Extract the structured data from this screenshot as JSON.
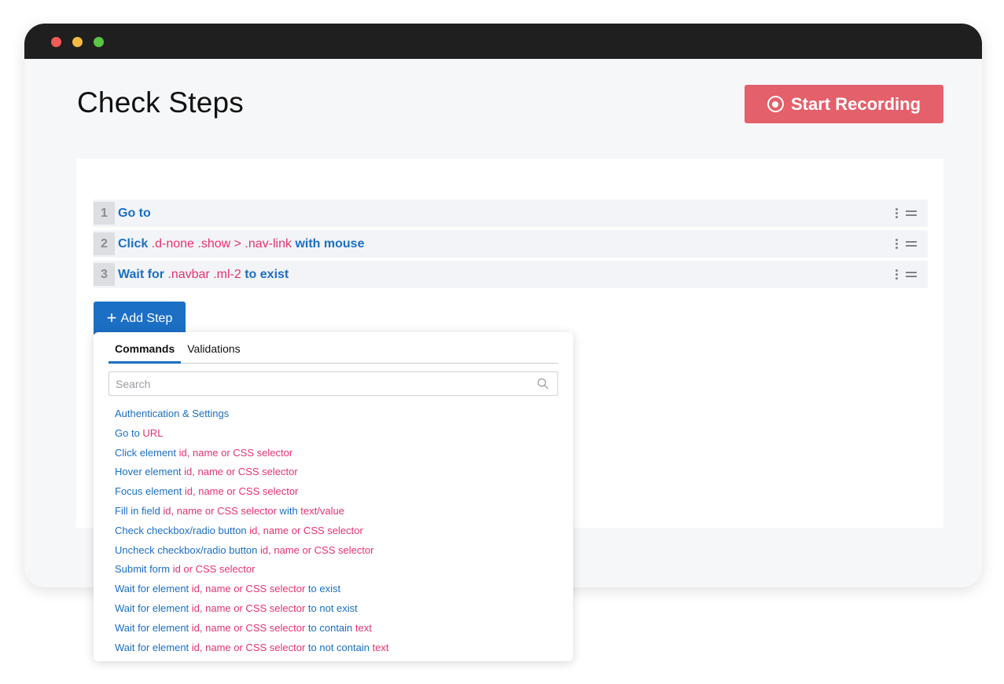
{
  "window": {
    "title": "Check Steps",
    "record_label": "Start Recording"
  },
  "steps": [
    {
      "num": "1",
      "parts": [
        {
          "t": "Go to",
          "k": "cmd"
        }
      ]
    },
    {
      "num": "2",
      "parts": [
        {
          "t": "Click ",
          "k": "cmd"
        },
        {
          "t": ".d-none .show > .nav-link",
          "k": "sel"
        },
        {
          "t": " with mouse",
          "k": "cmd"
        }
      ]
    },
    {
      "num": "3",
      "parts": [
        {
          "t": "Wait for ",
          "k": "cmd"
        },
        {
          "t": ".navbar .ml-2",
          "k": "sel"
        },
        {
          "t": " to exist",
          "k": "cmd"
        }
      ]
    }
  ],
  "add_step_label": "Add Step",
  "dropdown": {
    "tabs": [
      {
        "label": "Commands",
        "active": true
      },
      {
        "label": "Validations",
        "active": false
      }
    ],
    "search_placeholder": "Search",
    "commands": [
      [
        {
          "t": "Authentication & Settings",
          "k": "c"
        }
      ],
      [
        {
          "t": "Go to ",
          "k": "c"
        },
        {
          "t": "URL",
          "k": "p"
        }
      ],
      [
        {
          "t": "Click element ",
          "k": "c"
        },
        {
          "t": "id, name or CSS selector",
          "k": "p"
        }
      ],
      [
        {
          "t": "Hover element ",
          "k": "c"
        },
        {
          "t": "id, name or CSS selector",
          "k": "p"
        }
      ],
      [
        {
          "t": "Focus element ",
          "k": "c"
        },
        {
          "t": "id, name or CSS selector",
          "k": "p"
        }
      ],
      [
        {
          "t": "Fill in field ",
          "k": "c"
        },
        {
          "t": "id, name or CSS selector",
          "k": "p"
        },
        {
          "t": " with ",
          "k": "c"
        },
        {
          "t": "text/value",
          "k": "p"
        }
      ],
      [
        {
          "t": "Check checkbox/radio button ",
          "k": "c"
        },
        {
          "t": "id, name or CSS selector",
          "k": "p"
        }
      ],
      [
        {
          "t": "Uncheck checkbox/radio button ",
          "k": "c"
        },
        {
          "t": "id, name or CSS selector",
          "k": "p"
        }
      ],
      [
        {
          "t": "Submit form ",
          "k": "c"
        },
        {
          "t": "id or CSS selector",
          "k": "p"
        }
      ],
      [
        {
          "t": "Wait for element ",
          "k": "c"
        },
        {
          "t": "id, name or CSS selector",
          "k": "p"
        },
        {
          "t": " to exist",
          "k": "c"
        }
      ],
      [
        {
          "t": "Wait for element ",
          "k": "c"
        },
        {
          "t": "id, name or CSS selector",
          "k": "p"
        },
        {
          "t": " to not exist",
          "k": "c"
        }
      ],
      [
        {
          "t": "Wait for element ",
          "k": "c"
        },
        {
          "t": "id, name or CSS selector",
          "k": "p"
        },
        {
          "t": " to contain ",
          "k": "c"
        },
        {
          "t": "text",
          "k": "p"
        }
      ],
      [
        {
          "t": "Wait for element ",
          "k": "c"
        },
        {
          "t": "id, name or CSS selector",
          "k": "p"
        },
        {
          "t": " to not contain ",
          "k": "c"
        },
        {
          "t": "text",
          "k": "p"
        }
      ]
    ]
  },
  "colors": {
    "accent_blue": "#1b6fc4",
    "selector_pink": "#e6336e",
    "record_red": "#e4606b"
  },
  "icons": {
    "record": "record-icon",
    "plus": "plus-icon",
    "search": "search-icon",
    "kebab": "kebab-menu-icon",
    "drag": "drag-handle-icon"
  }
}
